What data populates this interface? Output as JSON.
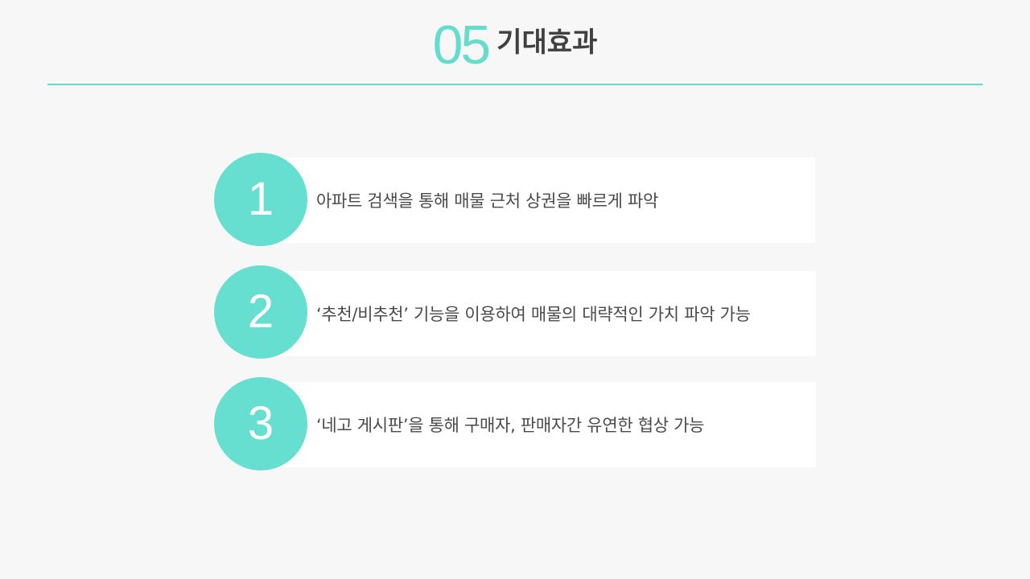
{
  "header": {
    "number": "05",
    "title": "기대효과"
  },
  "items": [
    {
      "number": "1",
      "text": "아파트 검색을 통해 매물 근처 상권을 빠르게 파악"
    },
    {
      "number": "2",
      "text": "‘추천/비추천’ 기능을 이용하여 매물의 대략적인 가치 파악 가능"
    },
    {
      "number": "3",
      "text": "‘네고 게시판’을 통해 구매자, 판매자간 유연한 협상 가능"
    }
  ],
  "colors": {
    "accent": "#66dfd1",
    "background": "#f7f7f7",
    "text": "#4a4a4a",
    "title": "#404040"
  }
}
